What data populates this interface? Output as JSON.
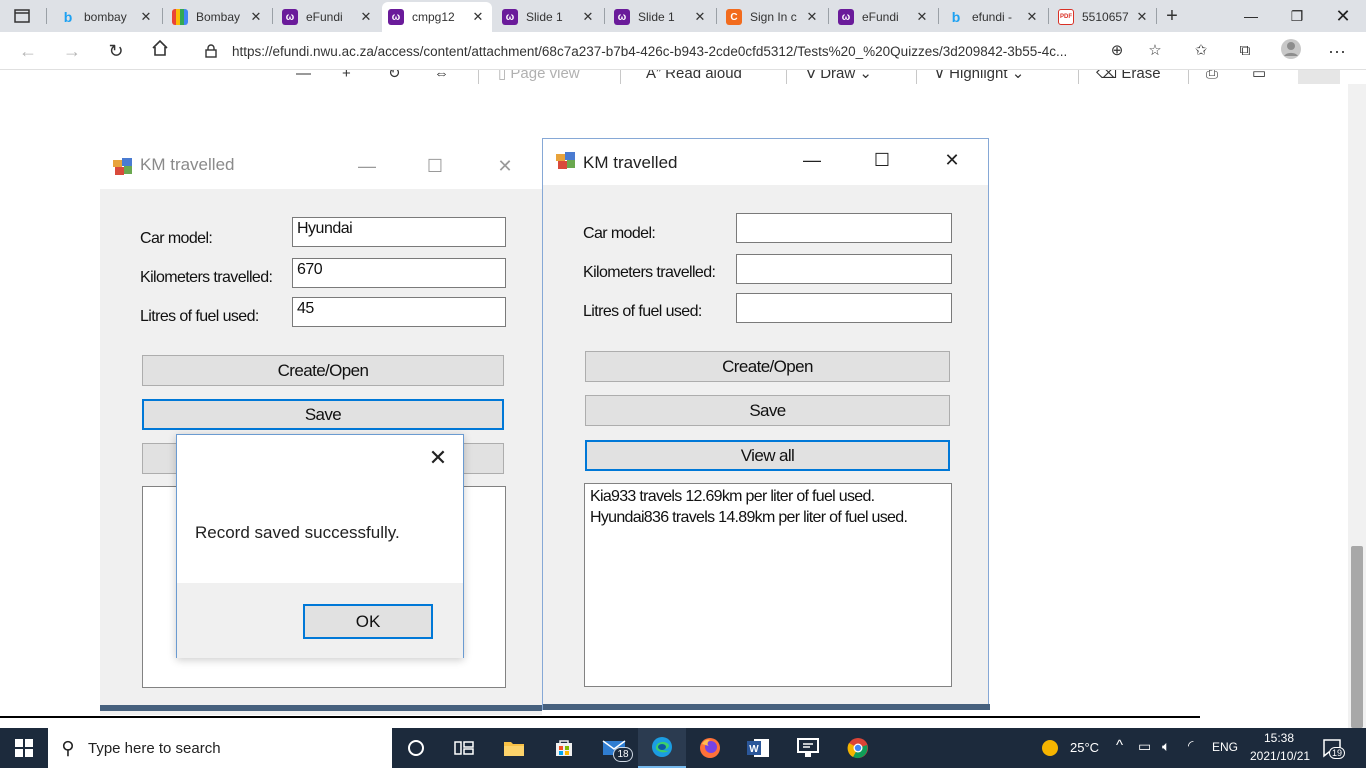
{
  "browser": {
    "tabs": [
      {
        "title": "bombay",
        "favicon": "bing-icon",
        "color": "#1da1f2"
      },
      {
        "title": "Bombay",
        "favicon": "colorful-bars-icon",
        "color": "#f4b400"
      },
      {
        "title": "eFundi",
        "favicon": "efundi-icon",
        "color": "#6a1b9a"
      },
      {
        "title": "cmpg12",
        "favicon": "efundi-icon",
        "color": "#6a1b9a",
        "active": true
      },
      {
        "title": "Slide 1",
        "favicon": "efundi-icon",
        "color": "#6a1b9a"
      },
      {
        "title": "Slide 1",
        "favicon": "efundi-icon",
        "color": "#6a1b9a"
      },
      {
        "title": "Sign In c",
        "favicon": "c-icon",
        "color": "#f26b1d"
      },
      {
        "title": "eFundi",
        "favicon": "efundi-icon",
        "color": "#6a1b9a"
      },
      {
        "title": "efundi -",
        "favicon": "bing-icon",
        "color": "#1da1f2"
      },
      {
        "title": "5510657",
        "favicon": "pdf-icon",
        "color": "#d93025"
      }
    ],
    "url": "https://efundi.nwu.ac.za/access/content/attachment/68c7a237-b7b4-426c-b943-2cde0cfd5312/Tests%20_%20Quizzes/3d209842-3b55-4c..."
  },
  "pdf_toolbar": {
    "page_view": "Page view",
    "read_aloud": "Read aloud",
    "draw": "Draw",
    "highlight": "Highlight",
    "erase": "Erase"
  },
  "form_left": {
    "title": "KM travelled",
    "car_model_label": "Car model:",
    "km_label": "Kilometers travelled:",
    "litres_label": "Litres of fuel used:",
    "car_model_value": "Hyundai",
    "km_value": "670",
    "litres_value": "45",
    "create_open": "Create/Open",
    "save": "Save"
  },
  "message_box": {
    "text": "Record saved successfully.",
    "ok": "OK"
  },
  "form_right": {
    "title": "KM travelled",
    "car_model_label": "Car model:",
    "km_label": "Kilometers travelled:",
    "litres_label": "Litres of fuel used:",
    "car_model_value": "",
    "km_value": "",
    "litres_value": "",
    "create_open": "Create/Open",
    "save": "Save",
    "view_all": "View all",
    "list_lines": [
      "Kia933 travels 12.69km per liter of fuel used.",
      "Hyundai836 travels 14.89km per liter of fuel used."
    ]
  },
  "taskbar": {
    "search_placeholder": "Type here to search",
    "mail_badge": "18",
    "weather": "25°C",
    "language": "ENG",
    "time": "15:38",
    "date": "2021/10/21",
    "notification_count": "19"
  }
}
